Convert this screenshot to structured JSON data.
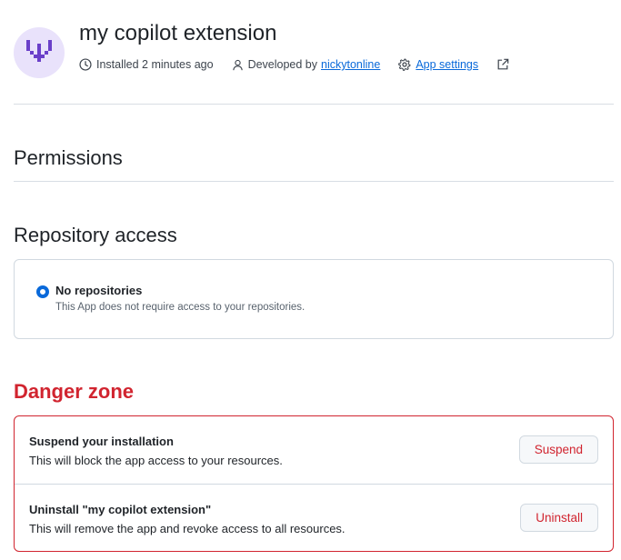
{
  "header": {
    "app_name": "my copilot extension",
    "installed_text": "Installed 2 minutes ago",
    "developed_by_text": "Developed by",
    "developer_link": "nickytonline",
    "app_settings_link": "App settings"
  },
  "permissions": {
    "title": "Permissions"
  },
  "repository_access": {
    "title": "Repository access",
    "option_label": "No repositories",
    "option_description": "This App does not require access to your repositories.",
    "selected": true
  },
  "danger_zone": {
    "title": "Danger zone",
    "suspend": {
      "title": "Suspend your installation",
      "description": "This will block the app access to your resources.",
      "button_label": "Suspend"
    },
    "uninstall": {
      "title": "Uninstall \"my copilot extension\"",
      "description": "This will remove the app and revoke access to all resources.",
      "button_label": "Uninstall"
    }
  },
  "colors": {
    "accent": "#0969da",
    "danger": "#d1242f",
    "avatar_bg": "#e9e2fb",
    "logo": "#6a3fc9"
  },
  "icons": {
    "avatar": "copilot-extension-logo-icon",
    "installed": "clock-icon",
    "developer": "person-icon",
    "settings": "gear-icon",
    "external": "external-link-icon"
  }
}
